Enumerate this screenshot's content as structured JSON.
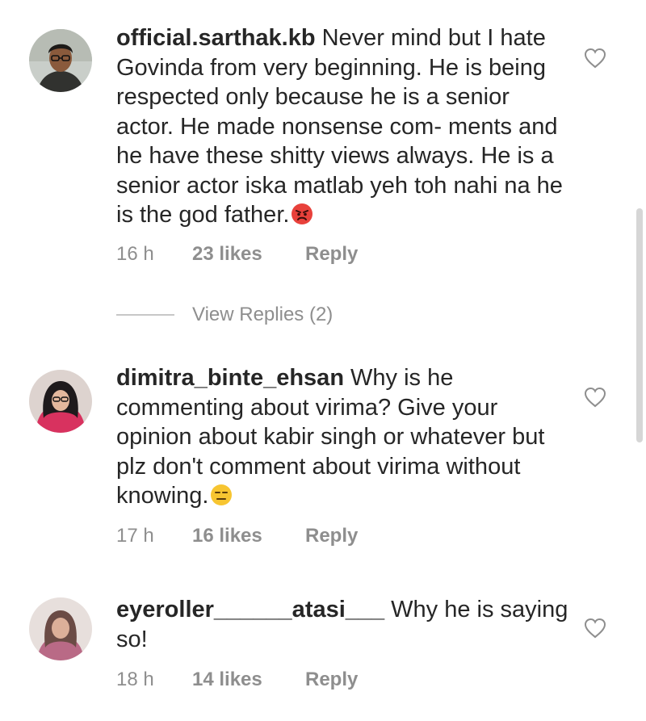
{
  "comments": [
    {
      "username": "official.sarthak.kb",
      "text": "Never mind but I hate Govinda from very beginning. He is being respected only because he is a senior actor. He made nonsense com- ments and he have these shitty views always. He is a senior actor iska matlab yeh toh nahi na he is the god father.",
      "emoji": "angry-face",
      "time": "16 h",
      "likes": "23 likes",
      "reply": "Reply"
    },
    {
      "username": "dimitra_binte_ehsan",
      "text": "Why is he commenting about virima? Give your opinion about kabir singh or whatever but plz don't comment about virima without knowing.",
      "emoji": "expressionless-face",
      "time": "17 h",
      "likes": "16 likes",
      "reply": "Reply"
    },
    {
      "username": "eyeroller______atasi___",
      "text": "Why he is saying so!",
      "time": "18 h",
      "likes": "14 likes",
      "reply": "Reply"
    }
  ],
  "view_replies": "View Replies (2)",
  "icons": {
    "like": "heart-outline-icon",
    "muted_text": "#8e8e8e",
    "text": "#262626"
  }
}
